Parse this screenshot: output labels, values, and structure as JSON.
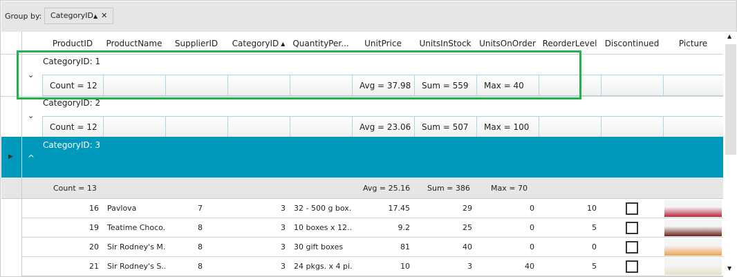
{
  "group_panel": {
    "label": "Group by:",
    "chip": "CategoryID",
    "chip_sort": "▲",
    "chip_close": "✕"
  },
  "columns": [
    "ProductID",
    "ProductName",
    "SupplierID",
    "CategoryID",
    "QuantityPer...",
    "UnitPrice",
    "UnitsInStock",
    "UnitsOnOrder",
    "ReorderLevel",
    "Discontinued",
    "Picture"
  ],
  "sort_indicator": "▲",
  "groups": [
    {
      "title": "CategoryID: 1",
      "count": "Count = 12",
      "avg": "Avg = 37.98",
      "sum": "Sum = 559",
      "max": "Max = 40",
      "expanded": false
    },
    {
      "title": "CategoryID: 2",
      "count": "Count = 12",
      "avg": "Avg = 23.06",
      "sum": "Sum = 507",
      "max": "Max = 100",
      "expanded": false
    },
    {
      "title": "CategoryID: 3",
      "count": "Count = 13",
      "avg": "Avg = 25.16",
      "sum": "Sum = 386",
      "max": "Max = 70",
      "expanded": true
    }
  ],
  "rows": [
    {
      "id": "16",
      "name": "Pavlova",
      "supplier": "7",
      "category": "3",
      "qty": "32 - 500 g box...",
      "price": "17.45",
      "stock": "29",
      "order": "0",
      "reorder": "10",
      "pic": "#b8283c"
    },
    {
      "id": "19",
      "name": "Teatime Choco...",
      "supplier": "8",
      "category": "3",
      "qty": "10 boxes x 12...",
      "price": "9.2",
      "stock": "25",
      "order": "0",
      "reorder": "5",
      "pic": "#6a2318"
    },
    {
      "id": "20",
      "name": "Sir Rodney's M...",
      "supplier": "8",
      "category": "3",
      "qty": "30 gift boxes",
      "price": "81",
      "stock": "40",
      "order": "0",
      "reorder": "0",
      "pic": "#f0a050"
    },
    {
      "id": "21",
      "name": "Sir Rodney's S...",
      "supplier": "8",
      "category": "3",
      "qty": "24 pkgs. x 4 pi...",
      "price": "10",
      "stock": "3",
      "order": "40",
      "reorder": "5",
      "pic": "#e8e0c8"
    }
  ],
  "colors": {
    "accent": "#0099bb",
    "highlight": "#22b14c"
  }
}
